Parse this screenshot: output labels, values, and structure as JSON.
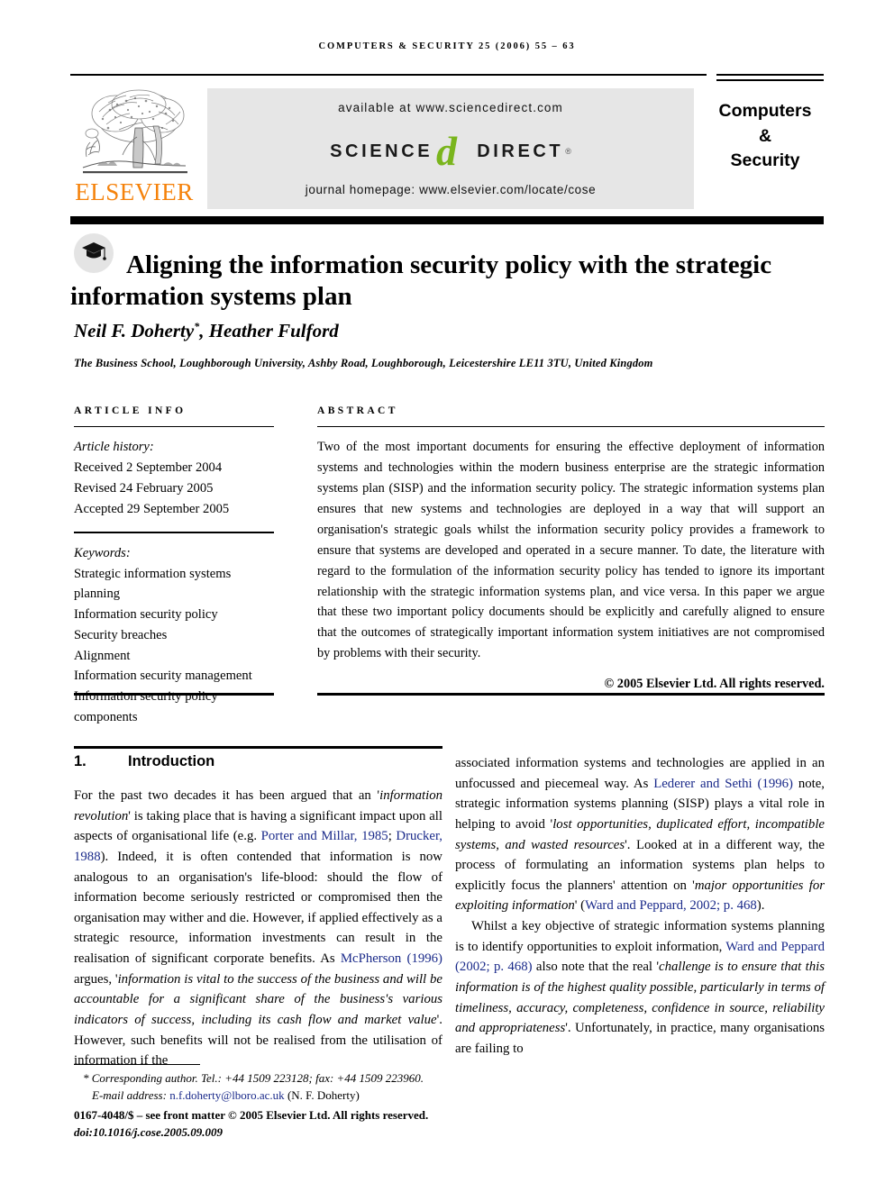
{
  "running_head": "Computers & Security 25 (2006) 55 – 63",
  "header": {
    "publisher_name": "ELSEVIER",
    "publisher_logo_alt": "elsevier-tree-logo",
    "sciencedirect": {
      "available_at": "available at www.sciencedirect.com",
      "logo_science": "SCIENCE",
      "logo_d": "d",
      "logo_direct": "DIRECT",
      "logo_registered": "®",
      "journal_homepage": "journal homepage: www.elsevier.com/locate/cose"
    },
    "journal_title_lines": [
      "Computers",
      "&",
      "Security"
    ]
  },
  "title": {
    "icon": "graduation-cap-icon",
    "text": "Aligning the information security policy with the strategic information systems plan"
  },
  "authors": {
    "names": "Neil F. Doherty",
    "corresponding_marker": "*",
    "names_rest": ", Heather Fulford",
    "affiliation": "The Business School, Loughborough University, Ashby Road, Loughborough, Leicestershire LE11 3TU, United Kingdom"
  },
  "article_info": {
    "heading": "Article info",
    "history_label": "Article history:",
    "history": [
      "Received 2 September 2004",
      "Revised 24 February 2005",
      "Accepted 29 September 2005"
    ],
    "keywords_label": "Keywords:",
    "keywords": [
      "Strategic information systems planning",
      "Information security policy",
      "Security breaches",
      "Alignment",
      "Information security management",
      "Information security policy components"
    ]
  },
  "abstract": {
    "heading": "Abstract",
    "text": "Two of the most important documents for ensuring the effective deployment of information systems and technologies within the modern business enterprise are the strategic information systems plan (SISP) and the information security policy. The strategic information systems plan ensures that new systems and technologies are deployed in a way that will support an organisation's strategic goals whilst the information security policy provides a framework to ensure that systems are developed and operated in a secure manner. To date, the literature with regard to the formulation of the information security policy has tended to ignore its important relationship with the strategic information systems plan, and vice versa. In this paper we argue that these two important policy documents should be explicitly and carefully aligned to ensure that the outcomes of strategically important information system initiatives are not compromised by problems with their security.",
    "copyright": "© 2005 Elsevier Ltd. All rights reserved."
  },
  "section": {
    "number": "1.",
    "title": "Introduction"
  },
  "body": {
    "left_col": {
      "p1_a": "For the past two decades it has been argued that an '",
      "p1_italic1": "information revolution",
      "p1_b": "' is taking place that is having a significant impact upon all aspects of organisational life (e.g. ",
      "p1_cite1": "Porter and Millar, 1985",
      "p1_c": "; ",
      "p1_cite2": "Drucker, 1988",
      "p1_d": "). Indeed, it is often contended that information is now analogous to an organisation's life-blood: should the flow of information become seriously restricted or compromised then the organisation may wither and die. However, if applied effectively as a strategic resource, information investments can result in the realisation of significant corporate benefits. As ",
      "p1_cite3": "McPherson (1996)",
      "p1_e": " argues, '",
      "p1_italic2": "information is vital to the success of the business and will be accountable for a significant share of the business's various indicators of success, including its cash flow and market value",
      "p1_f": "'. However, such benefits will not be realised from the utilisation of information if the"
    },
    "right_col": {
      "p1_a": "associated information systems and technologies are applied in an unfocussed and piecemeal way. As ",
      "p1_cite1": "Lederer and Sethi (1996)",
      "p1_b": " note, strategic information systems planning (SISP) plays a vital role in helping to avoid '",
      "p1_italic1": "lost opportunities, duplicated effort, incompatible systems, and wasted resources",
      "p1_c": "'. Looked at in a different way, the process of formulating an information systems plan helps to explicitly focus the planners' attention on '",
      "p1_italic2": "major opportunities for exploiting information",
      "p1_d": "' (",
      "p1_cite2": "Ward and Peppard, 2002; p. 468",
      "p1_e": ").",
      "p2_a": "Whilst a key objective of strategic information systems planning is to identify opportunities to exploit information, ",
      "p2_cite1": "Ward and Peppard (2002; p. 468)",
      "p2_b": " also note that the real '",
      "p2_italic1": "challenge is to ensure that this information is of the highest quality possible, particularly in terms of timeliness, accuracy, completeness, confidence in source, reliability and appropriateness",
      "p2_c": "'. Unfortunately, in practice, many organisations are failing to"
    }
  },
  "footnote": {
    "corresponding": "* Corresponding author. Tel.: +44 1509 223128; fax: +44 1509 223960.",
    "email_label": "E-mail address:",
    "email": "n.f.doherty@lboro.ac.uk",
    "email_owner": "(N. F. Doherty)",
    "front_matter": "0167-4048/$ – see front matter © 2005 Elsevier Ltd. All rights reserved.",
    "doi": "doi:10.1016/j.cose.2005.09.009"
  },
  "colors": {
    "elsevier_orange": "#f5820b",
    "sciencedirect_green": "#7ab51d",
    "citation_blue": "#1a2a8a",
    "sd_box_gray": "#e6e6e6"
  }
}
